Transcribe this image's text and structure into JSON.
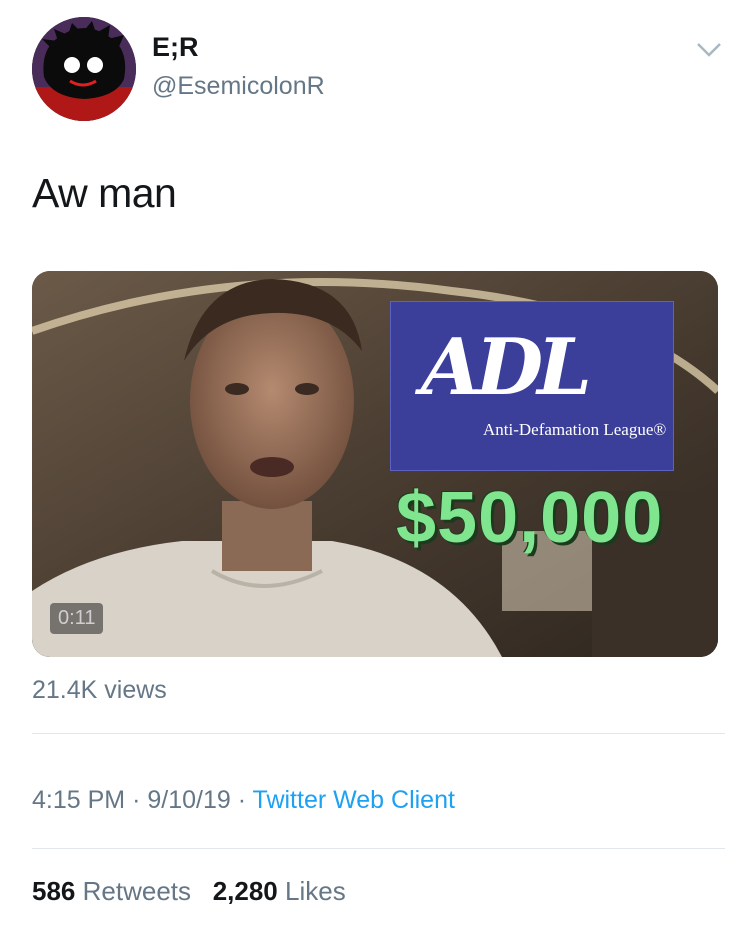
{
  "author": {
    "display_name": "E;R",
    "handle": "@EsemicolonR"
  },
  "tweet": {
    "text": "Aw man"
  },
  "media": {
    "overlay_title": "ADL",
    "overlay_subtitle": "Anti-Defamation League®",
    "overlay_amount": "$50,000",
    "duration": "0:11"
  },
  "views_label": "21.4K views",
  "meta": {
    "time": "4:15 PM",
    "date": "9/10/19",
    "separator": "·",
    "client": "Twitter Web Client"
  },
  "stats": {
    "retweets_count": "586",
    "retweets_label": "Retweets",
    "likes_count": "2,280",
    "likes_label": "Likes"
  },
  "colors": {
    "link": "#1da1f2",
    "secondary_text": "#657786",
    "primary_text": "#14171a",
    "money_green": "#7fe58e",
    "adl_blue": "#3b3f9a"
  },
  "icons": [
    "avatar-image",
    "chevron-down-icon"
  ]
}
